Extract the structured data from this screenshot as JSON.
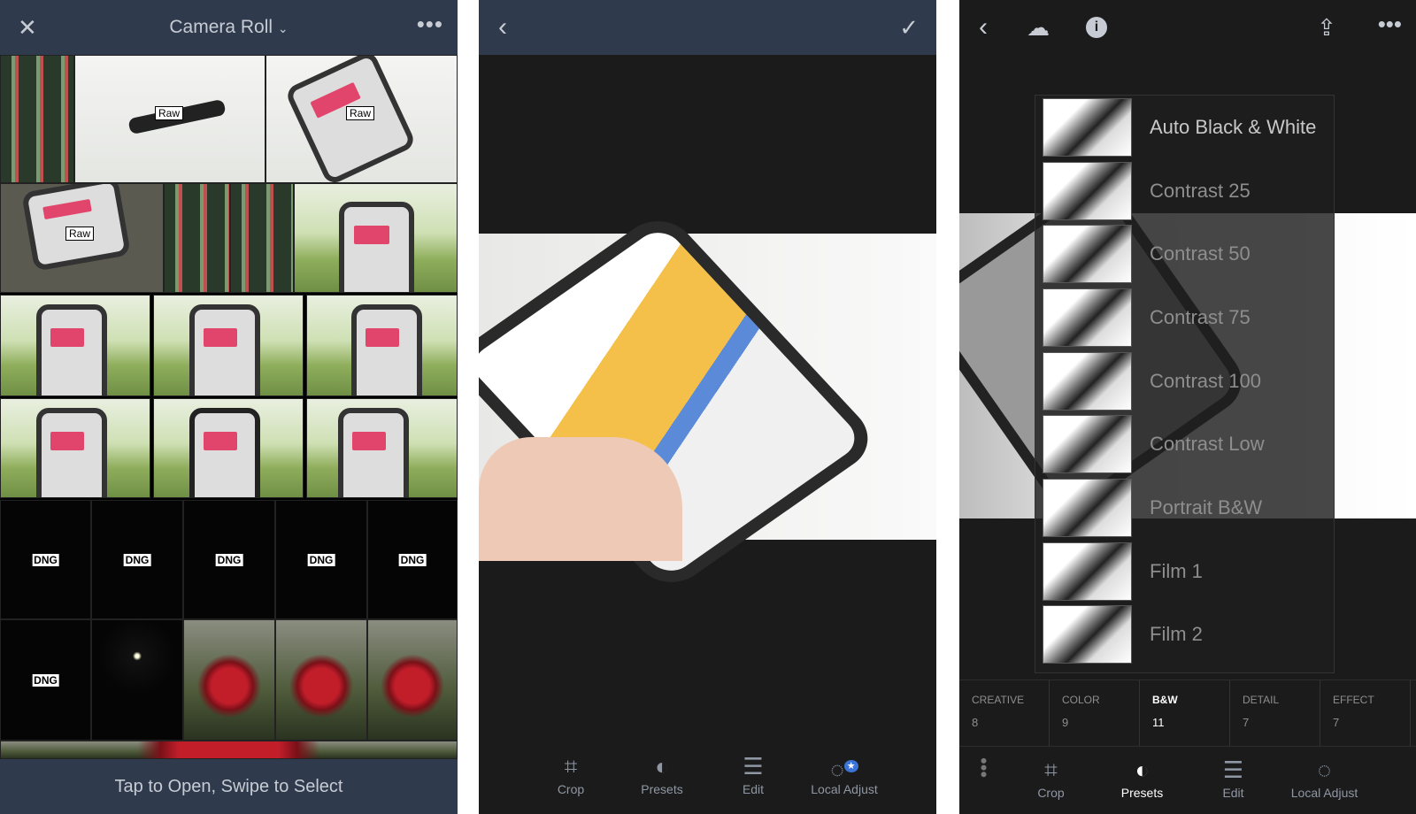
{
  "camera_roll": {
    "title": "Camera Roll",
    "close_icon": "close-icon",
    "dropdown_icon": "chevron-down-icon",
    "more_icon": "more-icon",
    "raw_label": "Raw",
    "dng_label": "DNG",
    "footer": "Tap to Open, Swipe to Select"
  },
  "editor": {
    "back_icon": "chevron-left-icon",
    "confirm_icon": "checkmark-icon",
    "tools": [
      {
        "label": "Crop",
        "icon": "crop-icon"
      },
      {
        "label": "Presets",
        "icon": "presets-icon"
      },
      {
        "label": "Edit",
        "icon": "sliders-icon"
      },
      {
        "label": "Local Adjust",
        "icon": "local-adjust-icon"
      }
    ]
  },
  "presets_view": {
    "icons": [
      "chevron-left-icon",
      "cloud-icon",
      "info-icon",
      "share-icon",
      "more-icon"
    ],
    "presets": [
      "Auto Black & White",
      "Contrast 25",
      "Contrast 50",
      "Contrast 75",
      "Contrast 100",
      "Contrast Low",
      "Portrait B&W",
      "Film 1",
      "Film 2"
    ],
    "categories": [
      {
        "label": "CREATIVE",
        "count": "8"
      },
      {
        "label": "COLOR",
        "count": "9"
      },
      {
        "label": "B&W",
        "count": "11",
        "active": true
      },
      {
        "label": "DETAIL",
        "count": "7"
      },
      {
        "label": "EFFECT",
        "count": "7"
      }
    ],
    "tools": [
      {
        "label": "Crop"
      },
      {
        "label": "Presets",
        "active": true
      },
      {
        "label": "Edit"
      },
      {
        "label": "Local Adjust"
      }
    ]
  }
}
